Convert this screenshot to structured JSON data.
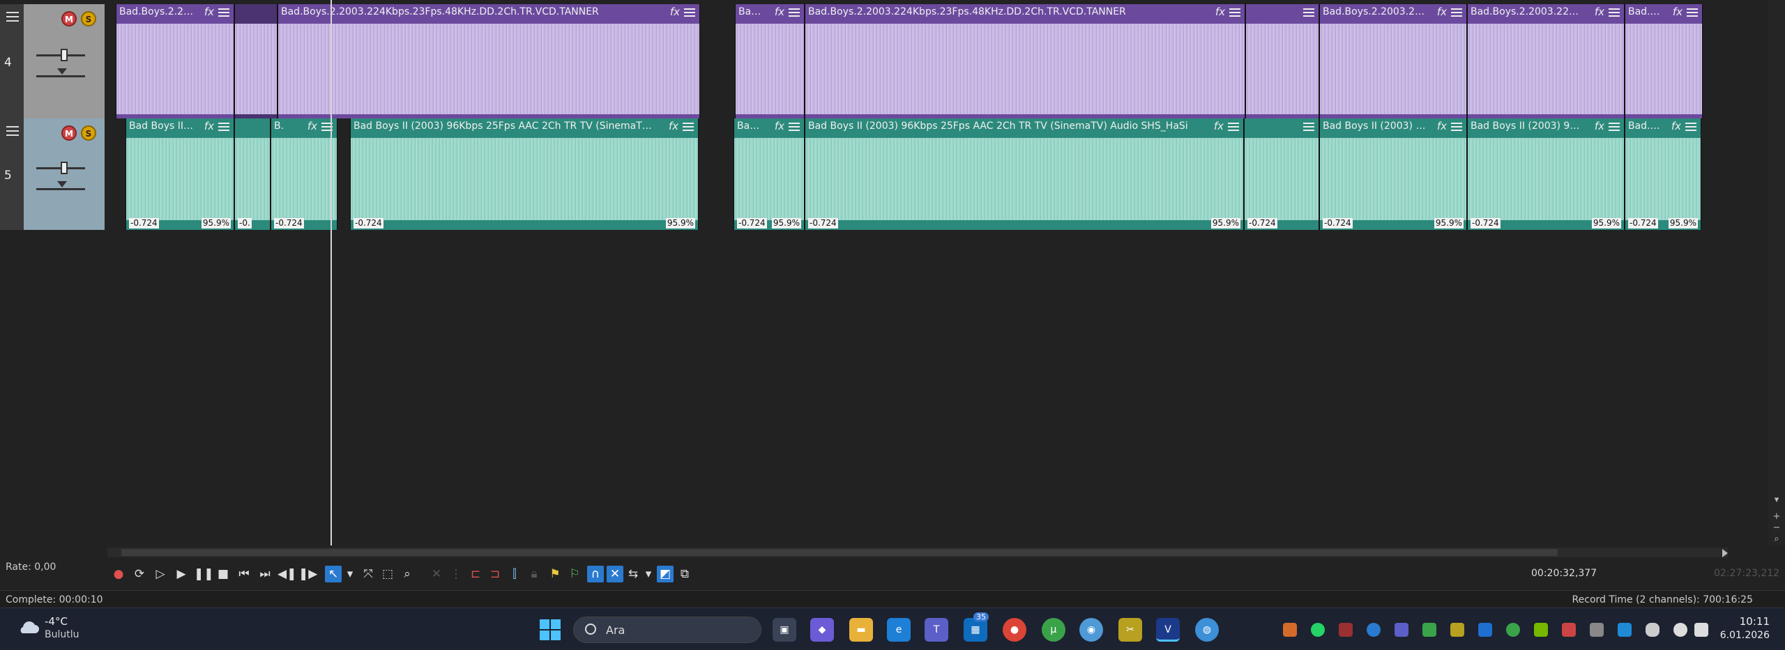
{
  "tracks": [
    {
      "number": "4",
      "mute_label": "M",
      "solo_label": "S",
      "clips": [
        {
          "title": "Bad.Boys.2.20..."
        },
        {
          "title": ""
        },
        {
          "title": "Bad.Boys.2.2003.224Kbps.23Fps.48KHz.DD.2Ch.TR.VCD.TANNER"
        },
        {
          "title": "Bad..."
        },
        {
          "title": "Bad.Boys.2.2003.224Kbps.23Fps.48KHz.DD.2Ch.TR.VCD.TANNER"
        },
        {
          "title": ""
        },
        {
          "title": "Bad.Boys.2.2003.224K..."
        },
        {
          "title": "Bad.Boys.2.2003.224Kbp..."
        },
        {
          "title": "Bad.Bo..."
        }
      ]
    },
    {
      "number": "5",
      "mute_label": "M",
      "solo_label": "S",
      "clips": [
        {
          "title": "Bad Boys II (...",
          "left_tag": "-0.724",
          "right_tag": "95.9%"
        },
        {
          "title": "",
          "left_tag": "-0.",
          "right_tag": ""
        },
        {
          "title": "B.",
          "left_tag": "-0.724",
          "right_tag": ""
        },
        {
          "title": "Bad Boys II (2003) 96Kbps 25Fps AAC 2Ch TR TV (SinemaTV) Audio SHS...",
          "left_tag": "-0.724",
          "right_tag": "95.9%"
        },
        {
          "title": "Bad ...",
          "left_tag": "-0.724",
          "right_tag": "95.9%"
        },
        {
          "title": "Bad Boys II (2003) 96Kbps 25Fps AAC 2Ch TR TV (SinemaTV) Audio SHS_HaSi",
          "left_tag": "-0.724",
          "right_tag": "95.9%"
        },
        {
          "title": "",
          "left_tag": "-0.724",
          "right_tag": ""
        },
        {
          "title": "Bad Boys II (2003) 96K...",
          "left_tag": "-0.724",
          "right_tag": "95.9%"
        },
        {
          "title": "Bad Boys II (2003) 96Kb...",
          "left_tag": "-0.724",
          "right_tag": "95.9%"
        },
        {
          "title": "Bad.Bo...",
          "left_tag": "-0.724",
          "right_tag": "95.9%"
        }
      ]
    }
  ],
  "transport": {
    "rate": "Rate: 0,00",
    "timecode": "00:20:32,377",
    "end_timecode": "02:27:23,212"
  },
  "status": {
    "complete": "Complete: 00:00:10",
    "record_time": "Record Time (2 channels): 700:16:25"
  },
  "taskbar": {
    "temperature": "-4°C",
    "condition": "Bulutlu",
    "search_placeholder": "Ara",
    "badge_count": "35",
    "time": "10:11",
    "date": "6.01.2026"
  },
  "colors": {
    "track4_clip": "#6b4a9e",
    "track5_clip": "#2c8a7c",
    "accent": "#2a7bd0"
  }
}
